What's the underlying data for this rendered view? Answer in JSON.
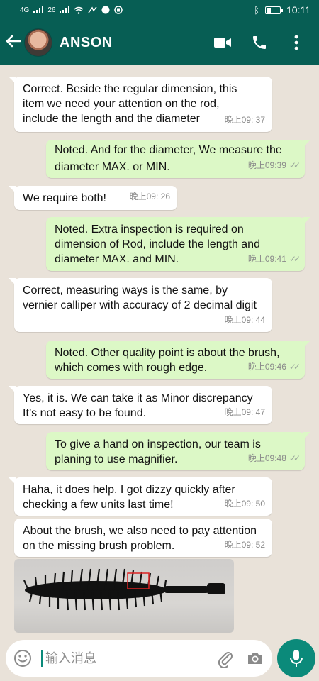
{
  "status_bar": {
    "network_left": "4G",
    "network_right": "26",
    "time": "10:11"
  },
  "header": {
    "contact_name": "ANSON",
    "icons": [
      "back-arrow-icon",
      "video-call-icon",
      "phone-icon",
      "more-vert-icon"
    ]
  },
  "messages": [
    {
      "side": "in",
      "text": "Correct. Beside the regular dimension, this item we need your attention on the rod, include the length and the diameter",
      "time": "晚上09: 37"
    },
    {
      "side": "out",
      "text": "Noted. And for the diameter, We measure the diameter MAX. or MIN.",
      "time": "晚上09:39"
    },
    {
      "side": "in",
      "text": "We require both!",
      "time": "晚上09: 26"
    },
    {
      "side": "out",
      "text": "Noted. Extra inspection is required on dimension of Rod, include the length and diameter MAX. and MIN.",
      "time": "晚上09:41"
    },
    {
      "side": "in",
      "text": "Correct, measuring ways is the same, by vernier calliper with accuracy of 2 decimal digit",
      "time": "晚上09: 44"
    },
    {
      "side": "out",
      "text": "Noted. Other quality point is about the brush, which comes with rough edge.",
      "time": "晚上09:46"
    },
    {
      "side": "in",
      "text": "Yes, it is. We can take it as Minor discrepancy It’s not easy to be found.",
      "time": "晚上09: 47"
    },
    {
      "side": "out",
      "text": "To give a hand on inspection, our team is planing to use magnifier.",
      "time": "晚上09:48"
    },
    {
      "side": "in",
      "text": "Haha, it does help. I got dizzy quickly after checking a few units last time!",
      "time": "晚上09: 50"
    },
    {
      "side": "in",
      "text": "About the brush, we also need to pay attention on the missing brush problem.",
      "time": "晚上09: 52"
    }
  ],
  "photo": {
    "icon": "mascara-brush-photo"
  },
  "input": {
    "placeholder": "输入消息",
    "icons": [
      "emoji-icon",
      "attach-icon",
      "camera-icon",
      "mic-icon"
    ]
  },
  "colors": {
    "header": "#075e54",
    "outgoing_bubble": "#dcf8c6",
    "incoming_bubble": "#ffffff",
    "background": "#e9e2d9",
    "accent": "#0b8a7a"
  }
}
